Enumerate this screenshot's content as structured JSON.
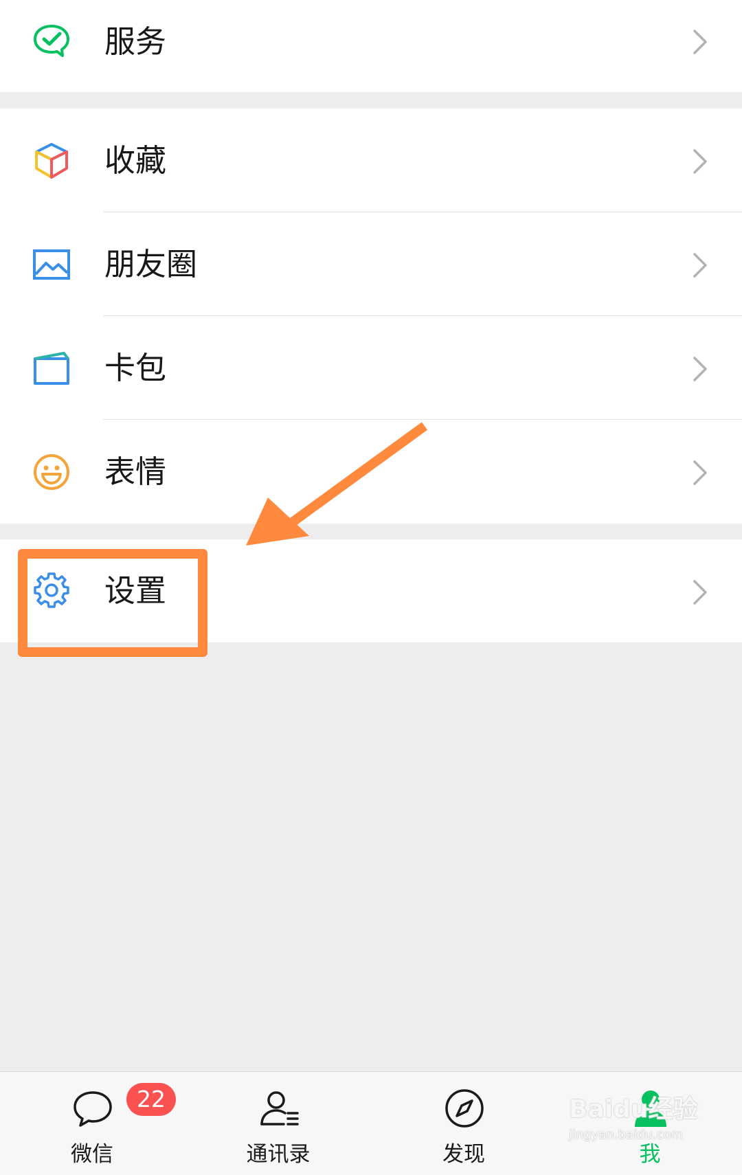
{
  "menu": {
    "service": {
      "label": "服务",
      "icon": "service-check-icon"
    },
    "group2": [
      {
        "key": "favorites",
        "label": "收藏",
        "icon": "cube-icon"
      },
      {
        "key": "moments",
        "label": "朋友圈",
        "icon": "image-icon"
      },
      {
        "key": "cards",
        "label": "卡包",
        "icon": "card-wallet-icon"
      },
      {
        "key": "stickers",
        "label": "表情",
        "icon": "smiley-icon"
      }
    ],
    "settings": {
      "label": "设置",
      "icon": "gear-icon"
    }
  },
  "tabbar": {
    "tabs": [
      {
        "label": "微信",
        "icon": "chat-bubble-icon",
        "badge": "22"
      },
      {
        "label": "通讯录",
        "icon": "contacts-icon"
      },
      {
        "label": "发现",
        "icon": "compass-icon"
      },
      {
        "label": "我",
        "icon": "person-icon",
        "active": true
      }
    ]
  },
  "watermark": {
    "text": "Baidu经验",
    "sub": "jingyan.baidu.com"
  },
  "colors": {
    "brand_green": "#07c160",
    "badge_red": "#fa5151",
    "annotation_orange": "#ff8a3d",
    "background": "#ededed"
  }
}
